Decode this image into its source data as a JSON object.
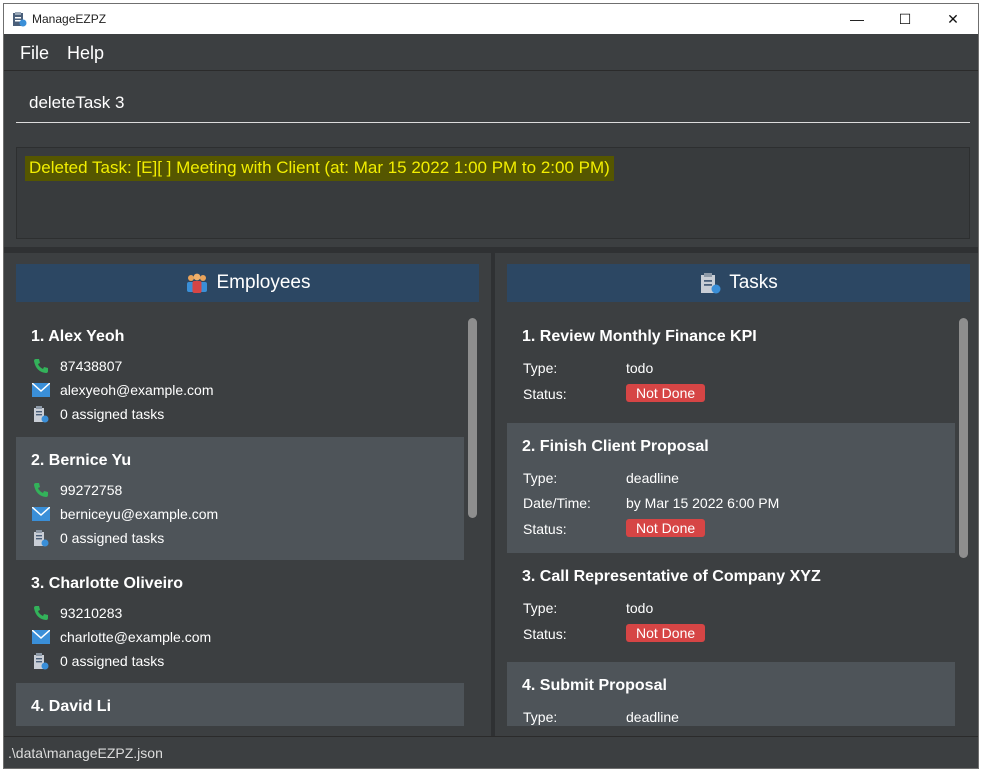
{
  "window": {
    "title": "ManageEZPZ",
    "minimize_glyph": "—",
    "maximize_glyph": "☐",
    "close_glyph": "✕"
  },
  "menu": {
    "items": [
      {
        "label": "File"
      },
      {
        "label": "Help"
      }
    ]
  },
  "command": {
    "value": "deleteTask 3"
  },
  "result": {
    "text": "Deleted Task: [E][ ] Meeting with Client (at: Mar 15 2022 1:00 PM to 2:00 PM)"
  },
  "employees": {
    "header": "Employees",
    "items": [
      {
        "title": "1.  Alex Yeoh",
        "phone": "87438807",
        "email": "alexyeoh@example.com",
        "tasks": "0 assigned tasks"
      },
      {
        "title": "2.  Bernice Yu",
        "phone": "99272758",
        "email": "berniceyu@example.com",
        "tasks": "0 assigned tasks"
      },
      {
        "title": "3.  Charlotte Oliveiro",
        "phone": "93210283",
        "email": "charlotte@example.com",
        "tasks": "0 assigned tasks"
      },
      {
        "title": "4.  David Li"
      }
    ]
  },
  "tasks": {
    "header": "Tasks",
    "type_label": "Type:",
    "datetime_label": "Date/Time:",
    "status_label": "Status:",
    "items": [
      {
        "title": "1.  Review Monthly Finance KPI",
        "type": "todo",
        "status": "Not Done"
      },
      {
        "title": "2.  Finish Client Proposal",
        "type": "deadline",
        "datetime": "by Mar 15 2022 6:00 PM",
        "status": "Not Done"
      },
      {
        "title": "3.  Call Representative of Company XYZ",
        "type": "todo",
        "status": "Not Done"
      },
      {
        "title": "4.  Submit Proposal",
        "type": "deadline"
      }
    ]
  },
  "status_bar": {
    "path": ".\\data\\manageEZPZ.json"
  },
  "colors": {
    "accent_header": "#2c4763",
    "status_badge": "#d64545",
    "result_text": "#f2ee00",
    "phone_icon": "#33b25a",
    "email_icon": "#3a8fd8"
  },
  "icons": {
    "app": "clipboard-checklist-icon",
    "employees_header": "people-icon",
    "tasks_header": "clipboard-checklist-icon",
    "phone": "phone-icon",
    "email": "envelope-icon",
    "assigned_tasks": "clipboard-checklist-icon"
  }
}
